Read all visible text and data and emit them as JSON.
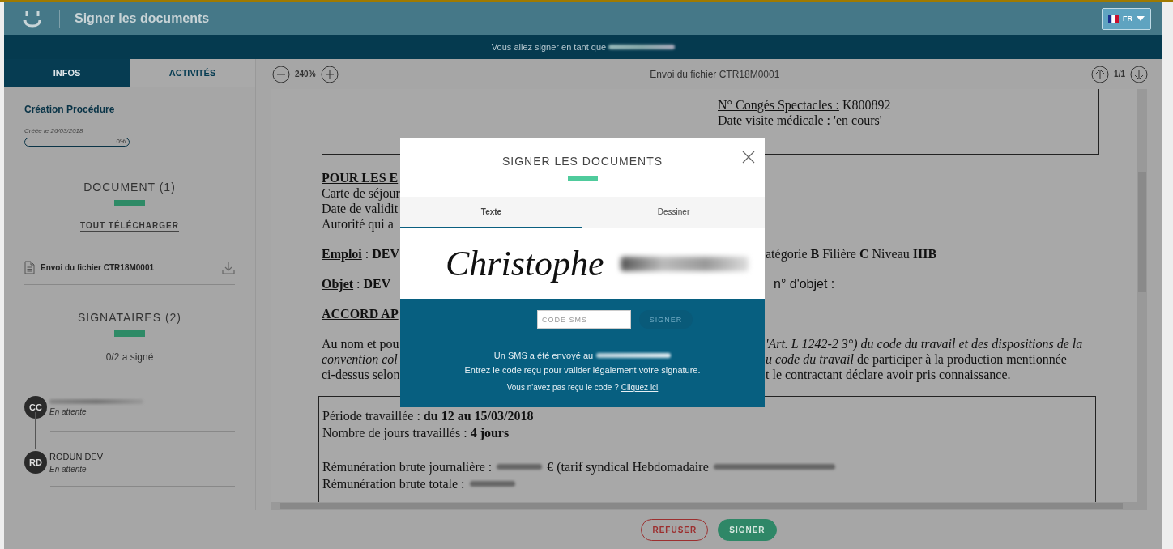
{
  "header": {
    "title": "Signer les documents",
    "language": "FR"
  },
  "banner": {
    "text": "Vous allez signer en tant que"
  },
  "sidebar": {
    "tabs": [
      {
        "label": "INFOS",
        "selected": true
      },
      {
        "label": "ACTIVITÉS",
        "selected": false
      }
    ],
    "procedure": {
      "title": "Création Procédure",
      "created": "Créée le 26/03/2018",
      "level": 0,
      "percent": "0%"
    },
    "documents": {
      "heading": "DOCUMENT (1)",
      "download_all": "TOUT TÉLÉCHARGER",
      "items": [
        {
          "name": "Envoi du fichier CTR18M0001"
        }
      ]
    },
    "signatories": {
      "heading": "SIGNATAIRES (2)",
      "summary": "0/2 a signé",
      "people": [
        {
          "initials": "CC",
          "status": "En attente"
        },
        {
          "initials": "RD",
          "name": "RODUN DEV",
          "status": "En attente"
        }
      ]
    }
  },
  "viewer": {
    "zoom": "240%",
    "title": "Envoi du fichier CTR18M0001",
    "page": "1/1",
    "top_lines": [
      {
        "label": "N° Congés Spectacles :",
        "value": " K800892"
      },
      {
        "label": "Date visite médicale",
        "value": " :  'en cours'"
      }
    ],
    "rows": [
      {
        "kind": "heading",
        "left": "POUR LES E"
      },
      {
        "kind": "text",
        "left": "Carte de séjour"
      },
      {
        "kind": "text",
        "left": "Date de validit"
      },
      {
        "kind": "text",
        "left": "Autorité qui a"
      },
      {
        "kind": "blank"
      },
      {
        "kind": "labeled",
        "label": "Emploi",
        "left": " : **DEV**",
        "right": "atégorie **B** Filière **C** Niveau **IIIB**"
      },
      {
        "kind": "blank"
      },
      {
        "kind": "labeled",
        "label": "Objet",
        "left": " : **DEV**",
        "right": "n° d'objet :",
        "right_sans": true
      },
      {
        "kind": "blank"
      },
      {
        "kind": "heading",
        "left": "ACCORD AP"
      },
      {
        "kind": "blank"
      },
      {
        "kind": "text",
        "left": "Au nom et pou",
        "right": "*'Art. L 1242-2 3°) du code du travail et des dispositions de la*"
      },
      {
        "kind": "text",
        "left": "*convention col*",
        "right": "*u code du travail* de participer à la production mentionnée"
      },
      {
        "kind": "text",
        "left": "ci-dessus selon",
        "right": "t le contractant déclare avoir pris connaissance."
      }
    ],
    "box_lines": [
      {
        "kind": "line",
        "parts": [
          {
            "kind": "text",
            "text": "Période travaillée : **du 12 au 15/03/2018**"
          }
        ]
      },
      {
        "kind": "line",
        "parts": [
          {
            "kind": "text",
            "text": "Nombre de jours travaillés : **4 jours**"
          }
        ]
      },
      {
        "kind": "blank"
      },
      {
        "kind": "line",
        "parts": [
          {
            "kind": "text",
            "text": "Rémunération brute journalière :"
          },
          {
            "kind": "redacted"
          },
          {
            "kind": "text",
            "text": "€  (tarif syndical  Hebdomadaire"
          },
          {
            "kind": "redacted"
          }
        ]
      },
      {
        "kind": "line",
        "parts": [
          {
            "kind": "text",
            "text": "Rémunération brute totale :"
          },
          {
            "kind": "redacted"
          }
        ]
      }
    ]
  },
  "modal": {
    "title": "SIGNER LES DOCUMENTS",
    "tabs": [
      {
        "label": "Texte",
        "selected": true
      },
      {
        "label": "Dessiner",
        "selected": false
      }
    ],
    "signature": "Christophe",
    "code_placeholder": "CODE SMS",
    "submit": {
      "label": "SIGNER",
      "disabled": true
    },
    "sent": "Un SMS a été envoyé au",
    "instruction": "Entrez le code reçu pour valider légalement votre signature.",
    "help": "Vous n'avez pas reçu le code ?",
    "help_link": "Cliquez ici"
  },
  "footer": {
    "buttons": [
      {
        "label": "REFUSER",
        "kind": "outline"
      },
      {
        "label": "SIGNER",
        "kind": "primary"
      }
    ]
  }
}
